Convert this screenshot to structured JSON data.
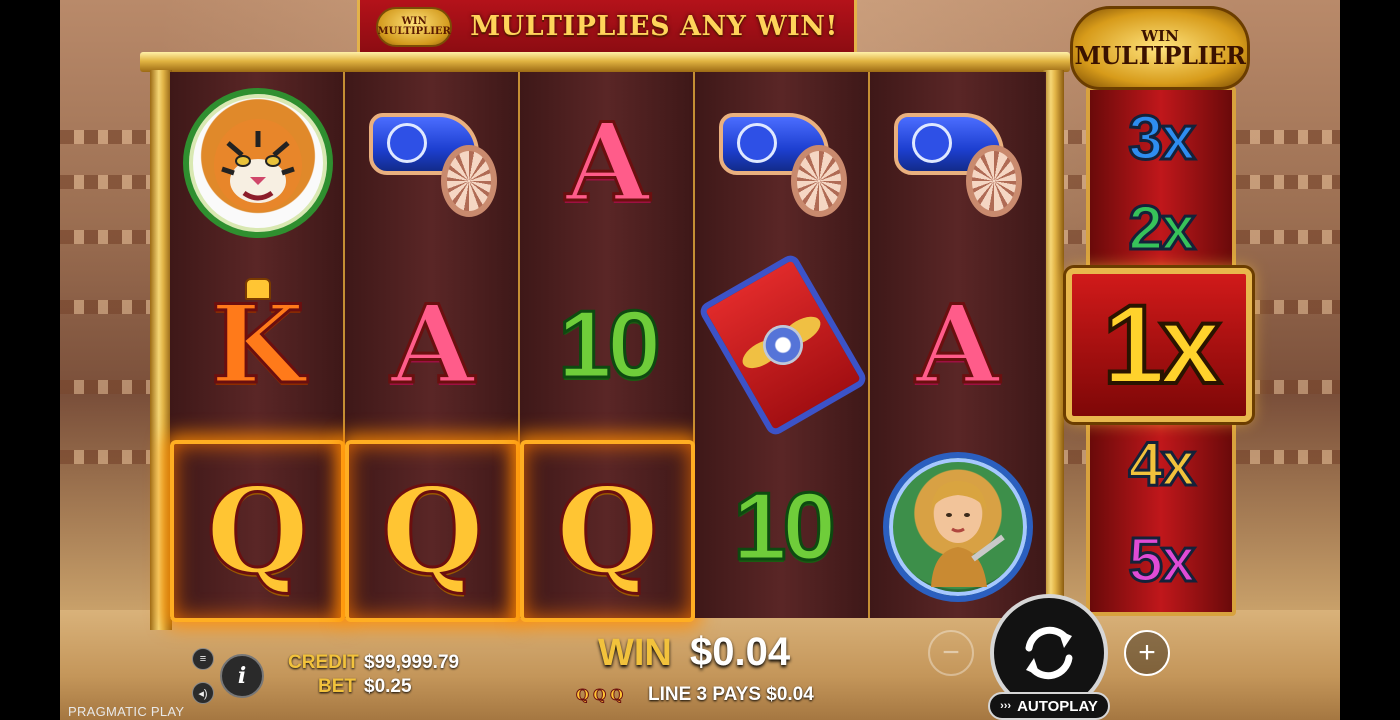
{
  "banner": {
    "badge_line1": "WIN",
    "badge_line2": "MULTIPLIER",
    "text": "MULTIPLIES ANY WIN!"
  },
  "multiplier": {
    "badge_line1": "WIN",
    "badge_line2": "MULTIPLIER",
    "values": [
      "3x",
      "2x",
      "1x",
      "4x",
      "5x"
    ],
    "active_value": "1x",
    "colors": {
      "3x": "#2e8df0",
      "2x": "#37c25a",
      "1x": "#ffd22c",
      "4x": "#f2c23c",
      "5x": "#e04bd6"
    }
  },
  "reels": [
    {
      "symbols": [
        {
          "id": "tiger",
          "icon": "tiger-icon"
        },
        {
          "id": "K",
          "label": "K"
        },
        {
          "id": "Q",
          "label": "Q",
          "winning": true
        }
      ]
    },
    {
      "symbols": [
        {
          "id": "chariot",
          "icon": "chariot-icon"
        },
        {
          "id": "A",
          "label": "A"
        },
        {
          "id": "Q",
          "label": "Q",
          "winning": true
        }
      ]
    },
    {
      "symbols": [
        {
          "id": "A",
          "label": "A"
        },
        {
          "id": "10",
          "label": "10"
        },
        {
          "id": "Q",
          "label": "Q",
          "winning": true
        }
      ]
    },
    {
      "symbols": [
        {
          "id": "chariot",
          "icon": "chariot-icon"
        },
        {
          "id": "shield",
          "icon": "shield-icon"
        },
        {
          "id": "10",
          "label": "10"
        }
      ]
    },
    {
      "symbols": [
        {
          "id": "chariot",
          "icon": "chariot-icon"
        },
        {
          "id": "A",
          "label": "A"
        },
        {
          "id": "gladiatrix",
          "icon": "woman-portrait-icon"
        }
      ]
    }
  ],
  "hud": {
    "credit_label": "CREDIT",
    "credit_value": "$99,999.79",
    "bet_label": "BET",
    "bet_value": "$0.25",
    "win_label": "WIN",
    "win_value": "$0.04",
    "line_symbol": "Q",
    "line_text": "LINE 3 PAYS $0.04",
    "minus_label": "−",
    "plus_label": "+",
    "autoplay_label": "AUTOPLAY",
    "info_label": "i",
    "brand": "PRAGMATIC PLAY"
  }
}
